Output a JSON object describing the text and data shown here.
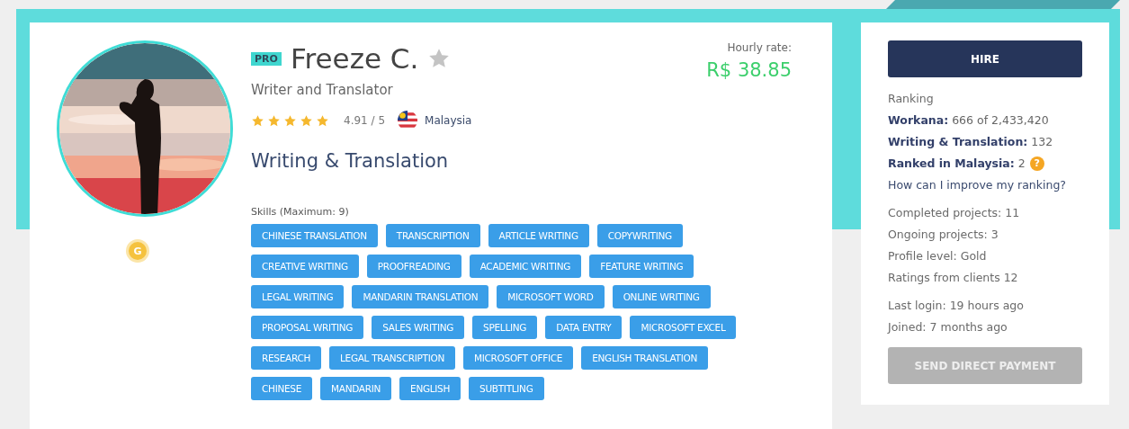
{
  "profile": {
    "badge": "PRO",
    "name": "Freeze C.",
    "favorite": false,
    "headline": "Writer and Translator",
    "stars": 5,
    "rating": "4.91 / 5",
    "country": "Malaysia",
    "category": "Writing & Translation",
    "level_badge": "G",
    "hourly_label": "Hourly rate:",
    "hourly_rate": "R$ 38.85"
  },
  "skills": {
    "label": "Skills (Maximum: 9)",
    "tags": [
      "CHINESE TRANSLATION",
      "TRANSCRIPTION",
      "ARTICLE WRITING",
      "COPYWRITING",
      "CREATIVE WRITING",
      "PROOFREADING",
      "ACADEMIC WRITING",
      "FEATURE WRITING",
      "LEGAL WRITING",
      "MANDARIN TRANSLATION",
      "MICROSOFT WORD",
      "ONLINE WRITING",
      "PROPOSAL WRITING",
      "SALES WRITING",
      "SPELLING",
      "DATA ENTRY",
      "MICROSOFT EXCEL",
      "RESEARCH",
      "LEGAL TRANSCRIPTION",
      "MICROSOFT OFFICE",
      "ENGLISH TRANSLATION",
      "CHINESE",
      "MANDARIN",
      "ENGLISH",
      "SUBTITLING"
    ]
  },
  "sidebar": {
    "hire_button": "HIRE",
    "ranking_title": "Ranking",
    "rankings": [
      {
        "label": "Workana:",
        "value": "666 of 2,433,420"
      },
      {
        "label": "Writing & Translation:",
        "value": "132"
      },
      {
        "label": "Ranked in Malaysia:",
        "value": "2",
        "help": "?"
      }
    ],
    "improve_link": "How can I improve my ranking?",
    "stats": [
      "Completed projects: 11",
      "Ongoing projects: 3",
      "Profile level: Gold",
      "Ratings from clients 12"
    ],
    "activity": [
      "Last login: 19 hours ago",
      "Joined: 7 months ago"
    ],
    "payment_button": "SEND DIRECT PAYMENT",
    "payment_disabled": true
  }
}
